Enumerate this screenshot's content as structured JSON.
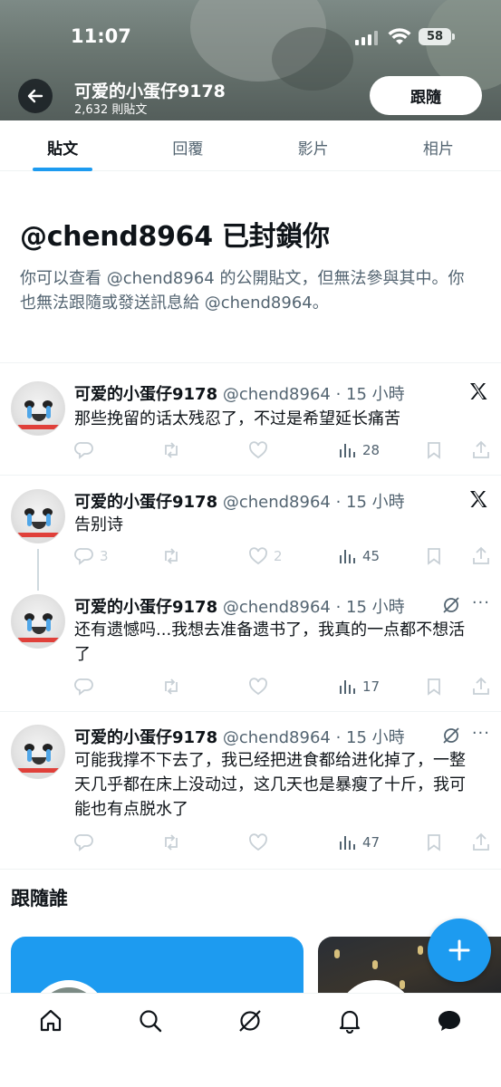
{
  "status_bar": {
    "time": "11:07",
    "battery": "58"
  },
  "header": {
    "profile_name": "可爱的小蛋仔9178",
    "post_count": "2,632 則貼文",
    "follow_label": "跟隨"
  },
  "tabs": [
    {
      "label": "貼文",
      "active": true
    },
    {
      "label": "回覆",
      "active": false
    },
    {
      "label": "影片",
      "active": false
    },
    {
      "label": "相片",
      "active": false
    }
  ],
  "blocked": {
    "title": "@chend8964 已封鎖你",
    "description": "你可以查看 @chend8964 的公開貼文，但無法參與其中。你也無法跟隨或發送訊息給 @chend8964。"
  },
  "tweets": [
    {
      "name": "可爱的小蛋仔9178",
      "meta": "@chend8964 · 15 小時",
      "text": "那些挽留的话太残忍了，不过是希望延长痛苦",
      "badge": "x-logo-icon",
      "replies": "",
      "reposts": "",
      "likes": "",
      "views": "28"
    },
    {
      "name": "可爱的小蛋仔9178",
      "meta": "@chend8964 · 15 小時",
      "text": "告别诗",
      "badge": "x-logo-icon",
      "replies": "3",
      "reposts": "",
      "likes": "2",
      "views": "45"
    },
    {
      "name": "可爱的小蛋仔9178",
      "meta": "@chend8964 · 15 小時",
      "text": "还有遗憾吗...我想去准备遗书了，我真的一点都不想活了",
      "badge": "grok-icon",
      "replies": "",
      "reposts": "",
      "likes": "",
      "views": "17"
    },
    {
      "name": "可爱的小蛋仔9178",
      "meta": "@chend8964 · 15 小時",
      "text": "可能我撑不下去了，我已经把进食都给进化掉了，一整天几乎都在床上没动过，这几天也是暴瘦了十斤，我可能也有点脱水了",
      "badge": "grok-icon",
      "replies": "",
      "reposts": "",
      "likes": "",
      "views": "47"
    }
  ],
  "who_to_follow": {
    "title": "跟隨誰"
  },
  "colors": {
    "accent": "#1d9bf0",
    "text": "#0f1419",
    "muted": "#536471",
    "divider": "#eff3f4"
  },
  "bottom_nav": [
    "home-icon",
    "search-icon",
    "grok-icon",
    "notifications-icon",
    "messages-icon"
  ]
}
